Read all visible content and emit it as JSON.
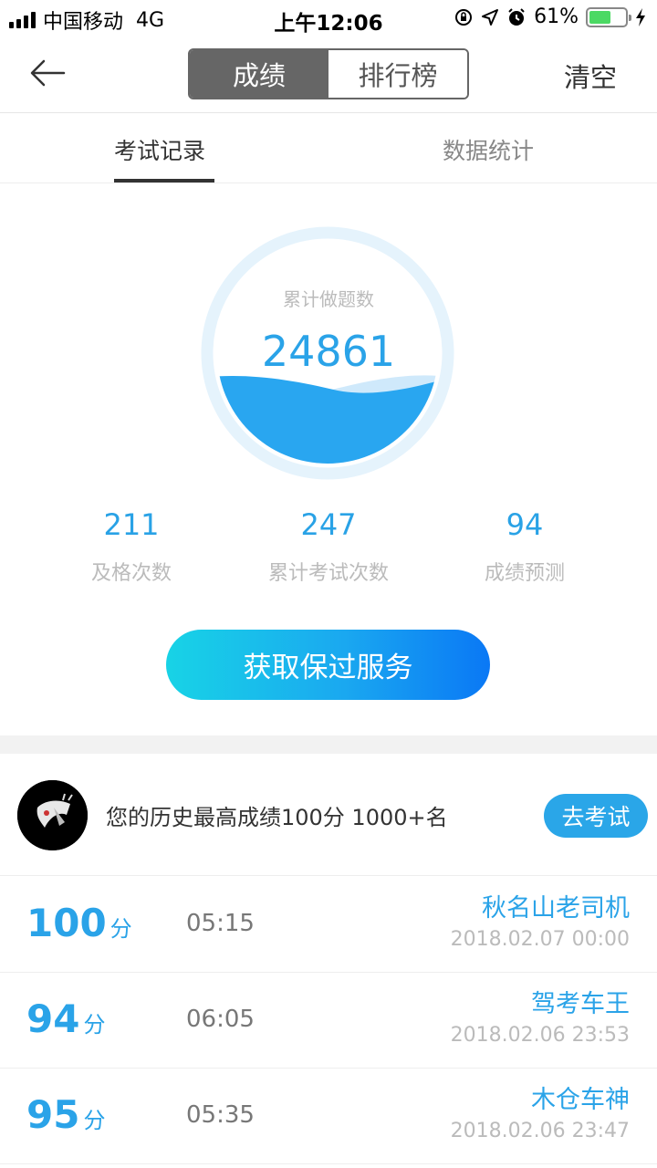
{
  "status_bar": {
    "carrier": "中国移动",
    "network": "4G",
    "time": "上午12:06",
    "battery": "61%",
    "battery_level": 0.61
  },
  "nav": {
    "segment_active": "成绩",
    "segment_inactive": "排行榜",
    "clear": "清空"
  },
  "tabs": {
    "records": "考试记录",
    "stats": "数据统计"
  },
  "summary": {
    "total_label": "累计做题数",
    "total_value": "24861"
  },
  "stats": [
    {
      "value": "211",
      "label": "及格次数"
    },
    {
      "value": "247",
      "label": "累计考试次数"
    },
    {
      "value": "94",
      "label": "成绩预测"
    }
  ],
  "cta": "获取保过服务",
  "best": {
    "text": "您的历史最高成绩100分  1000+名",
    "button": "去考试"
  },
  "records": [
    {
      "score": "100",
      "unit": "分",
      "duration": "05:15",
      "name": "秋名山老司机",
      "date": "2018.02.07 00:00"
    },
    {
      "score": "94",
      "unit": "分",
      "duration": "06:05",
      "name": "驾考车王",
      "date": "2018.02.06 23:53"
    },
    {
      "score": "95",
      "unit": "分",
      "duration": "05:35",
      "name": "木仓车神",
      "date": "2018.02.06 23:47"
    }
  ],
  "colors": {
    "accent": "#2aa3e8",
    "wave": "#29a6f0",
    "ring": "#e5f3fc"
  }
}
